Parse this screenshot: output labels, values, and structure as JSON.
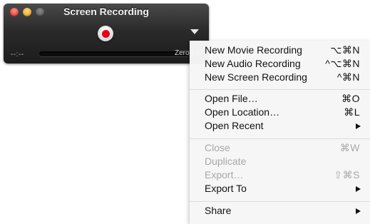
{
  "window": {
    "title": "Screen Recording",
    "time": "--:--",
    "size": "Zero KB"
  },
  "menu": {
    "groups": [
      [
        {
          "label": "New Movie Recording",
          "shortcut": "⌥⌘N",
          "enabled": true
        },
        {
          "label": "New Audio Recording",
          "shortcut": "^⌥⌘N",
          "enabled": true
        },
        {
          "label": "New Screen Recording",
          "shortcut": "^⌘N",
          "enabled": true
        }
      ],
      [
        {
          "label": "Open File…",
          "shortcut": "⌘O",
          "enabled": true
        },
        {
          "label": "Open Location…",
          "shortcut": "⌘L",
          "enabled": true
        },
        {
          "label": "Open Recent",
          "shortcut": "",
          "submenu": true,
          "enabled": true
        }
      ],
      [
        {
          "label": "Close",
          "shortcut": "⌘W",
          "enabled": false
        },
        {
          "label": "Duplicate",
          "shortcut": "",
          "enabled": false
        },
        {
          "label": "Export…",
          "shortcut": "⇧⌘S",
          "enabled": false
        },
        {
          "label": "Export To",
          "shortcut": "",
          "submenu": true,
          "enabled": true
        }
      ],
      [
        {
          "label": "Share",
          "shortcut": "",
          "submenu": true,
          "enabled": true
        }
      ]
    ]
  },
  "colors": {
    "record_red": "#e2001a",
    "disabled_text": "#a7a7a7"
  }
}
